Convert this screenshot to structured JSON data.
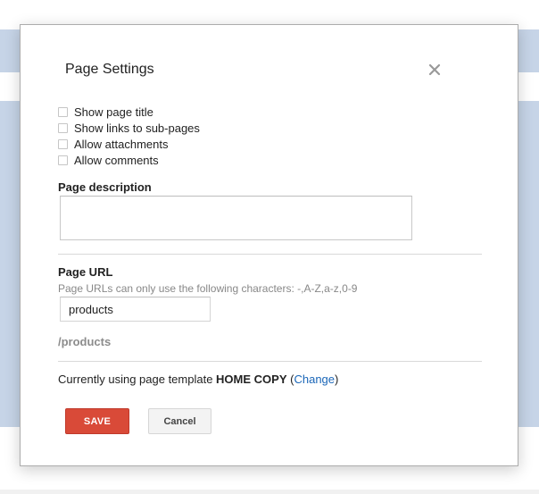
{
  "dialog": {
    "title": "Page Settings",
    "close_icon": "close-icon"
  },
  "options": [
    {
      "label": "Show page title",
      "checked": false
    },
    {
      "label": "Show links to sub-pages",
      "checked": false
    },
    {
      "label": "Allow attachments",
      "checked": false
    },
    {
      "label": "Allow comments",
      "checked": false
    }
  ],
  "description": {
    "label": "Page description",
    "value": ""
  },
  "url": {
    "label": "Page URL",
    "hint": "Page URLs can only use the following characters: -,A-Z,a-z,0-9",
    "value": "products",
    "preview": "/products"
  },
  "template": {
    "prefix": "Currently using page template ",
    "name": "HOME COPY",
    "open_paren": " (",
    "change_label": "Change",
    "close_paren": ")"
  },
  "buttons": {
    "save_label": "SAVE",
    "cancel_label": "Cancel"
  },
  "colors": {
    "save_bg": "#d94a38",
    "link": "#1a66b8",
    "background_band": "#c6d4e7"
  }
}
